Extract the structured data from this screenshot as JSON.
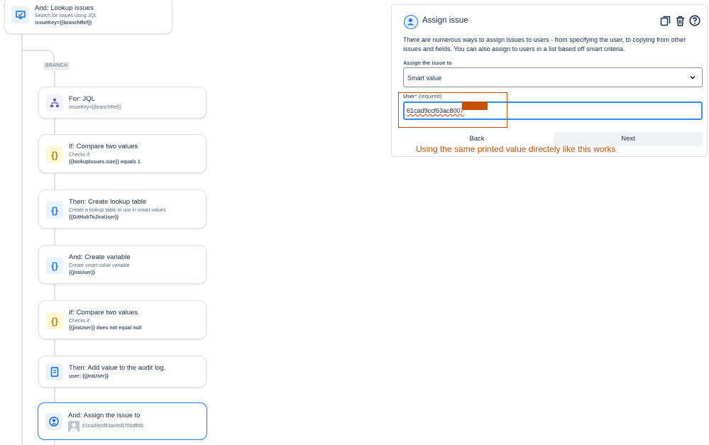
{
  "canvas": {
    "branch_tag": "BRANCH",
    "nodes": [
      {
        "prefix": "And:",
        "title": "Lookup issues",
        "sub": "Search for issues using JQL",
        "bold": "issueKey={{branchRef}}",
        "icon": "monitor-icon"
      },
      {
        "prefix": "For:",
        "title": "JQL",
        "sub": "issueKey={{branchRef}}",
        "bold": "",
        "icon": "branch-tree-icon"
      },
      {
        "prefix": "If:",
        "title": "Compare two values",
        "sub": "Checks if:",
        "bold": "{{lookupIssues.size}} equals 1",
        "icon": "curly-braces-icon"
      },
      {
        "prefix": "Then:",
        "title": "Create lookup table",
        "sub": "Create a lookup table to use in smart values",
        "bold": "{{GitHubToJiraUser}}",
        "icon": "curly-braces-icon"
      },
      {
        "prefix": "And:",
        "title": "Create variable",
        "sub": "Create smart value variable",
        "bold": "{{jiraUser}}",
        "icon": "curly-braces-icon"
      },
      {
        "prefix": "If:",
        "title": "Compare two values",
        "sub": "Checks if:",
        "bold": "{{jiraUser}} does not equal null",
        "icon": "curly-braces-icon"
      },
      {
        "prefix": "Then:",
        "title": "Add value to the audit log.",
        "sub": "",
        "bold": "user: {{jiraUser}}",
        "icon": "document-icon"
      },
      {
        "prefix": "And:",
        "title": "Assign the issue to",
        "sub": "61cad9ccf63ac800700dffd3",
        "bold": "",
        "icon": "user-circle-icon"
      }
    ]
  },
  "panel": {
    "title": "Assign issue",
    "description": "There are numerous ways to assign issues to users - from specifying the user, to copying from other issues and fields. You can also assign to users in a list based off smart criteria.",
    "assign_label": "Assign the issue to",
    "assign_value": "Smart value",
    "user_label": "User",
    "user_required": "* (required)",
    "user_value": "61cad9ccf63ac8007",
    "back_label": "Back",
    "next_label": "Next",
    "icons": [
      "copy-icon",
      "trash-icon",
      "help-icon"
    ]
  },
  "annotation": {
    "note": "Using the same printed value directely like this works",
    "color": "#c75000"
  },
  "colors": {
    "accent": "#1d7afc",
    "border": "#dfe1e6"
  }
}
